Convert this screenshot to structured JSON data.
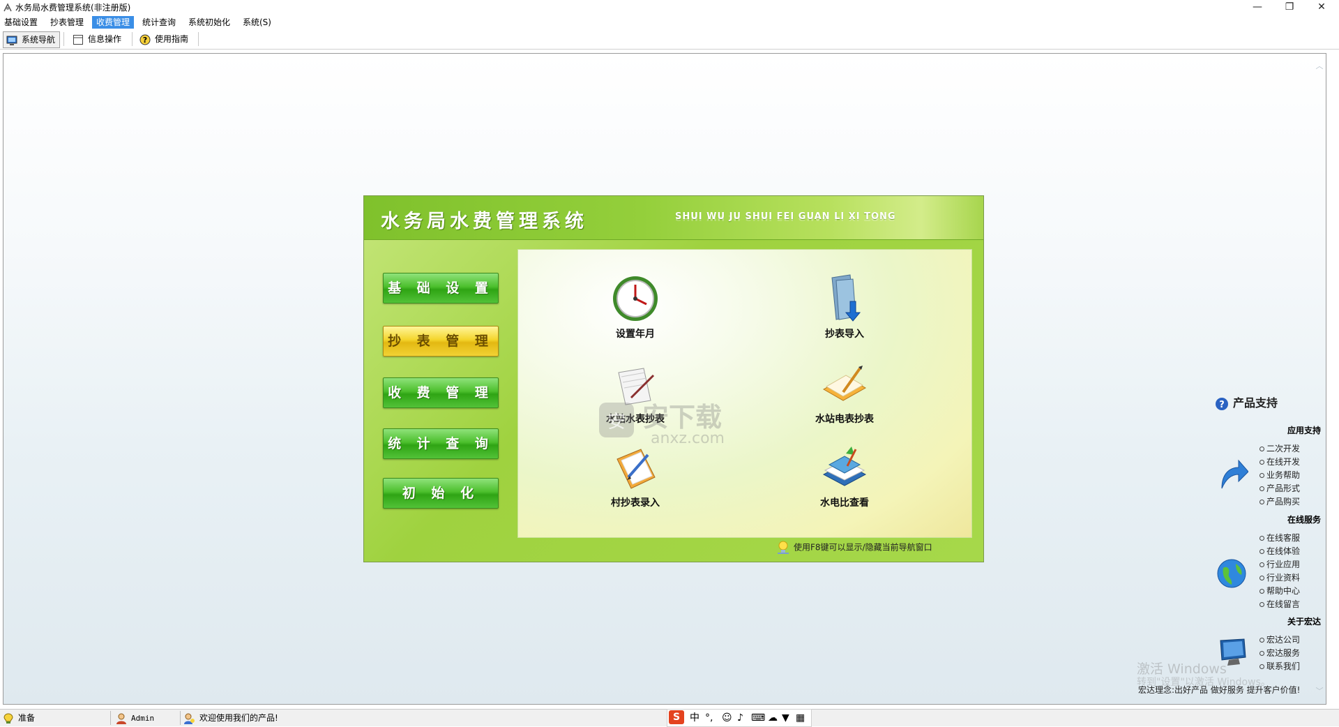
{
  "window": {
    "title": "水务局水费管理系统(非注册版)",
    "minimize": "—",
    "maximize": "❐",
    "close": "✕"
  },
  "menu": [
    "基础设置",
    "抄表管理",
    "收费管理",
    "统计查询",
    "系统初始化",
    "系统(S)"
  ],
  "menu_active_index": 2,
  "toolbar": {
    "nav_label": "系统导航",
    "info_label": "信息操作",
    "guide_label": "使用指南"
  },
  "panel": {
    "title_cn": "水务局水费管理系统",
    "title_pinyin": "SHUI WU JU SHUI FEI GUAN LI XI TONG",
    "nav_buttons": [
      "基 础 设 置",
      "抄 表 管 理",
      "收 费 管 理",
      "统 计 查 询",
      "初 始 化"
    ],
    "selected_index": 1,
    "items": [
      "设置年月",
      "抄表导入",
      "水站水表抄表",
      "水站电表抄表",
      "村抄表录入",
      "水电比查看"
    ],
    "hint": "使用F8键可以显示/隐藏当前导航窗口"
  },
  "support": {
    "title": "产品支持",
    "sections": [
      {
        "title": "应用支持",
        "icon": "curved-arrow-icon",
        "links": [
          "二次开发",
          "在线开发",
          "业务帮助",
          "产品形式",
          "产品购买"
        ]
      },
      {
        "title": "在线服务",
        "icon": "globe-icon",
        "links": [
          "在线客服",
          "在线体验",
          "行业应用",
          "行业资料",
          "帮助中心",
          "在线留言"
        ]
      },
      {
        "title": "关于宏达",
        "icon": "monitor-icon",
        "links": [
          "宏达公司",
          "宏达服务",
          "联系我们"
        ]
      }
    ],
    "slogan": "宏达理念:出好产品 做好服务 提升客户价值!"
  },
  "watermark": {
    "line1": "激活 Windows",
    "line2": "转到\"设置\"以激活 Windows。",
    "site": "安下载",
    "site_url": "anxz.com"
  },
  "status": {
    "ready": "准备",
    "user": "Admin",
    "welcome": "欢迎使用我们的产品!"
  },
  "ime": {
    "logo": "S",
    "lang": "中",
    "punct": "°,"
  },
  "colors": {
    "accent": "#3a8ee6",
    "panel_green": "#9fd23f",
    "button_green": "#2fa414",
    "button_yellow": "#f4d52c"
  }
}
